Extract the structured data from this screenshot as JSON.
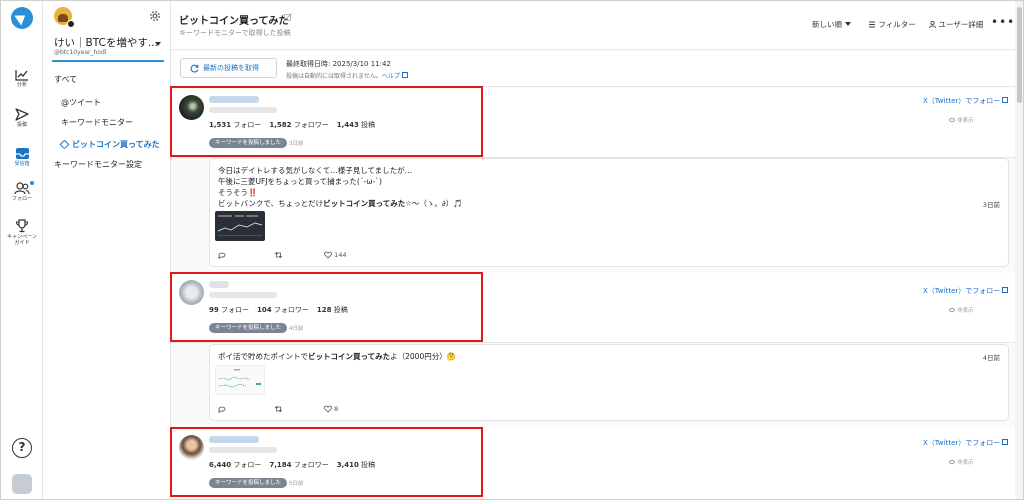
{
  "rail": {
    "items": [
      {
        "label": "分析",
        "icon": "chart-line-icon"
      },
      {
        "label": "投稿",
        "icon": "send-icon"
      },
      {
        "label": "受信箱",
        "icon": "inbox-icon"
      },
      {
        "label": "フォロー",
        "icon": "users-icon"
      },
      {
        "label": "キャンペーン\nガイド",
        "icon": "trophy-icon"
      }
    ],
    "help": "?"
  },
  "sidebar": {
    "account_name": "けい｜BTCを増やす...",
    "account_handle": "@btc10year_hodl",
    "links": [
      "すべて",
      "@ツイート",
      "キーワードモニター",
      "ビットコイン買ってみた",
      "キーワードモニター設定"
    ],
    "active_link": "ビットコイン買ってみた"
  },
  "header": {
    "title": "ビットコイン買ってみた",
    "subtitle": "キーワードモニターで取得した投稿",
    "sort_label": "新しい順",
    "filter_label": "フィルター",
    "user_detail_label": "ユーザー詳細",
    "more": "•••"
  },
  "refresh": {
    "button_label": "最新の投稿を取得",
    "last_fetch": "最終取得日時: 2025/3/10 11:42",
    "note": "投稿は自動的には取得されません。",
    "help_label": "ヘルプ"
  },
  "common": {
    "follow_link": "X（Twitter）でフォロー",
    "hide_label": "非表示",
    "keyword_badge": "キーワードを投稿しました",
    "follow_suffix": " フォロー",
    "follower_suffix": " フォロワー",
    "posts_suffix": " 投稿"
  },
  "users": [
    {
      "follows": "1,531",
      "followers": "1,582",
      "posts": "1,443",
      "time": "3日前"
    },
    {
      "follows": "99",
      "followers": "104",
      "posts": "128",
      "time": "4日前"
    },
    {
      "follows": "6,440",
      "followers": "7,184",
      "posts": "3,410",
      "time": "5日前"
    }
  ],
  "posts": [
    {
      "line1": "今日はデイトレする気がしなくて…様子見してましたが…",
      "line2": "午後に三菱UFJをちょっと買って捕まった(´-ω-`)",
      "line3": "そうそう‼️",
      "line4_pre": "ビットバンクで、ちょっとだけ",
      "line4_kw": "ビットコイン買ってみた",
      "line4_post": "☆～（ゝ。∂）🎵",
      "time": "3日前",
      "likes": "144"
    },
    {
      "line1_pre": "ポイ活で貯めたポイントで",
      "line1_kw": "ビットコイン買ってみた",
      "line1_post": "よ（2000円分）🤔",
      "time": "4日前",
      "likes": "8"
    }
  ],
  "colors": {
    "accent": "#1a73c9",
    "badge": "#7b8591",
    "highlight": "#e01818"
  }
}
